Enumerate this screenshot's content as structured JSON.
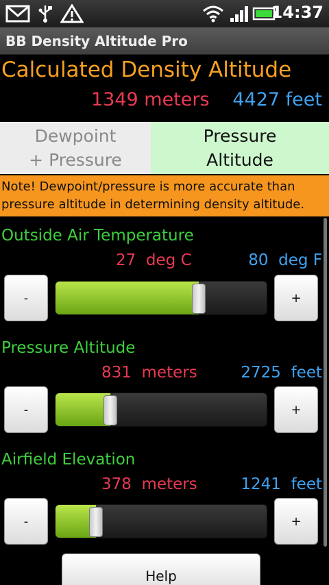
{
  "status_bar": {
    "time": "14:37",
    "icons": [
      "gmail-icon",
      "usb-icon",
      "warning-icon",
      "wifi-icon",
      "signal-icon",
      "battery-icon"
    ]
  },
  "title_bar": {
    "title": "BB Density Altitude Pro"
  },
  "result": {
    "heading": "Calculated Density Altitude",
    "meters": "1349 meters",
    "feet": "4427 feet"
  },
  "tabs": [
    {
      "label": "Dewpoint + Pressure",
      "selected": false
    },
    {
      "label": "Pressure Altitude",
      "selected": true
    }
  ],
  "note": "Note! Dewpoint/pressure is more accurate than pressure altitude in determining density altitude.",
  "controls": [
    {
      "label": "Outside Air Temperature",
      "left_value": "27",
      "left_unit": "deg C",
      "right_value": "80",
      "right_unit": "deg F",
      "level": 0.68,
      "minus_label": "-",
      "plus_label": "+"
    },
    {
      "label": "Pressure Altitude",
      "left_value": "831",
      "left_unit": "meters",
      "right_value": "2725",
      "right_unit": "feet",
      "level": 0.26,
      "minus_label": "-",
      "plus_label": "+"
    },
    {
      "label": "Airfield Elevation",
      "left_value": "378",
      "left_unit": "meters",
      "right_value": "1241",
      "right_unit": "feet",
      "level": 0.19,
      "minus_label": "-",
      "plus_label": "+"
    }
  ],
  "help_label": "Help",
  "colors": {
    "heading": "#f6a020",
    "metric": "#e83a52",
    "imperial": "#3fa2f0",
    "section_label": "#3ecf3e",
    "note_bg": "#f7961e",
    "selected_tab_bg": "#cdf7cd"
  }
}
